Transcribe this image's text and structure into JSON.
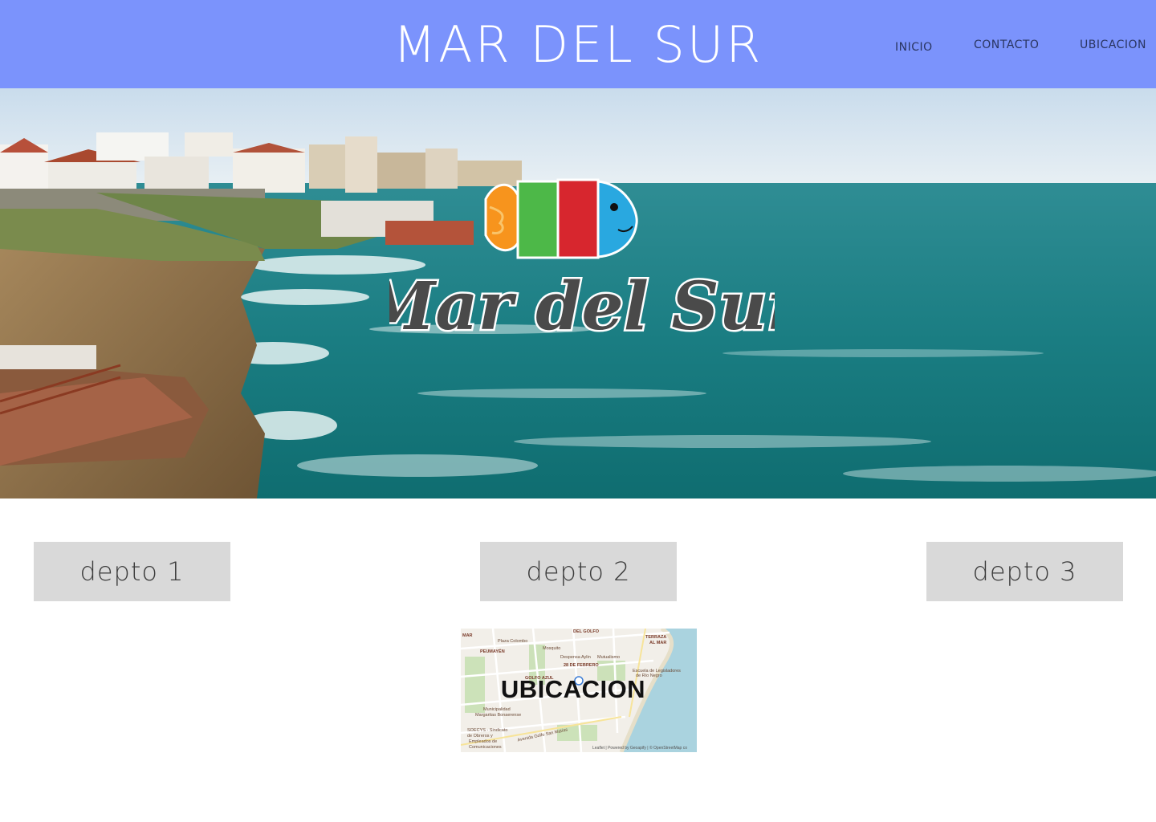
{
  "header": {
    "title": "MAR DEL SUR",
    "nav": [
      {
        "label": "INICIO"
      },
      {
        "label": "CONTACTO"
      },
      {
        "label": "UBICACION"
      }
    ],
    "background_color": "#7b93fc"
  },
  "hero": {
    "logo_text": "Mar del Sur",
    "logo_fish_colors": [
      "#f7941d",
      "#4db848",
      "#d7262e",
      "#29a8e0"
    ]
  },
  "deptos": [
    {
      "label": "depto 1"
    },
    {
      "label": "depto 2"
    },
    {
      "label": "depto 3"
    }
  ],
  "map": {
    "title": "UBICACION",
    "attribution": "Leaflet | Powered by Geoapify | © OpenStreetMap co",
    "labels": [
      {
        "text": "MAR",
        "bold": true
      },
      {
        "text": "Plaza Colombo",
        "bold": false
      },
      {
        "text": "DEL GOLFO",
        "bold": true
      },
      {
        "text": "TERRAZA",
        "bold": true
      },
      {
        "text": "AL MAR",
        "bold": true
      },
      {
        "text": "PEUMAYÉN",
        "bold": true
      },
      {
        "text": "Mosquito",
        "bold": false
      },
      {
        "text": "Despensa Aylin",
        "bold": false
      },
      {
        "text": "Mutualismo",
        "bold": false
      },
      {
        "text": "28 DE FEBRERO",
        "bold": true
      },
      {
        "text": "Escuela de Legisladores",
        "bold": false
      },
      {
        "text": "de Río Negro",
        "bold": false
      },
      {
        "text": "GOLFO AZUL",
        "bold": true
      },
      {
        "text": "Municipalidad",
        "bold": false
      },
      {
        "text": "Margaritas Bonaerense",
        "bold": false
      },
      {
        "text": "SOECYS - Sindicato",
        "bold": false
      },
      {
        "text": "de Obreros y",
        "bold": false
      },
      {
        "text": "Empleados de",
        "bold": false
      },
      {
        "text": "Comunicaciones",
        "bold": false
      },
      {
        "text": "Avenida Golfo San Matías",
        "bold": false
      }
    ]
  }
}
